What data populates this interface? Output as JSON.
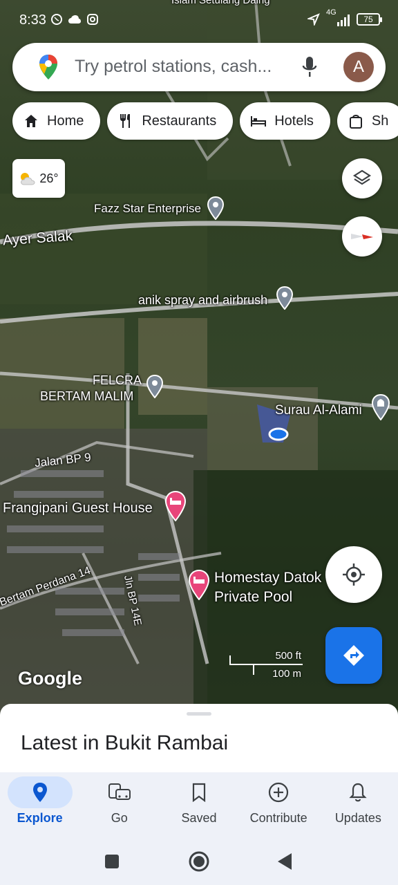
{
  "status_bar": {
    "time": "8:33",
    "left_icons": [
      "whatsapp-icon",
      "cloud-icon",
      "instagram-icon"
    ],
    "network": "4G",
    "battery": "75"
  },
  "search": {
    "placeholder": "Try petrol stations, cash...",
    "avatar_letter": "A"
  },
  "chips": [
    {
      "label": "Home",
      "icon": "home-icon"
    },
    {
      "label": "Restaurants",
      "icon": "restaurant-icon"
    },
    {
      "label": "Hotels",
      "icon": "hotel-icon"
    },
    {
      "label": "Sh",
      "icon": "shopping-bag-icon"
    }
  ],
  "weather": {
    "temp": "26°",
    "icon": "partly-cloudy-icon"
  },
  "map": {
    "top_label": "Islam Setulang Daing",
    "labels": {
      "fazz": "Fazz Star Enterprise",
      "ayer_salak": "Ayer Salak",
      "anik": "anik spray and airbrush",
      "felcra_1": "FELCRA",
      "felcra_2": "BERTAM MALIM",
      "surau": "Surau Al-Alami",
      "jalan_bp9": "Jalan BP 9",
      "frangipani": "Frangipani Guest House",
      "bertam_perdana": "Bertam Perdana 14",
      "jln_bp14e": "Jln BP 14E",
      "homestay_1": "Homestay Datok",
      "homestay_2": "Private Pool"
    },
    "logo": "Google",
    "scale_ft": "500 ft",
    "scale_m": "100 m"
  },
  "sheet": {
    "title": "Latest in Bukit Rambai"
  },
  "nav": [
    {
      "label": "Explore",
      "icon": "location-pin-icon",
      "active": true
    },
    {
      "label": "Go",
      "icon": "commute-icon",
      "active": false
    },
    {
      "label": "Saved",
      "icon": "bookmark-icon",
      "active": false
    },
    {
      "label": "Contribute",
      "icon": "add-circle-icon",
      "active": false
    },
    {
      "label": "Updates",
      "icon": "bell-icon",
      "active": false
    }
  ],
  "colors": {
    "accent": "#1a73e8",
    "active_nav": "#0b57d0",
    "hotel_pin": "#e8457a"
  }
}
